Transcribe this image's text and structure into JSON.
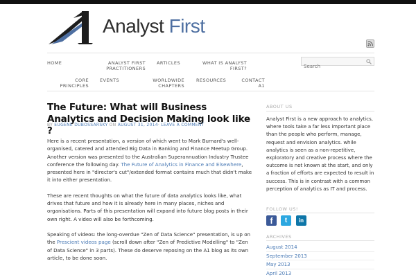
{
  "site": {
    "logo_word1": "Analyst",
    "logo_word2": "First",
    "brand_color": "#4e6fa1"
  },
  "nav": {
    "home": "HOME",
    "practitioners": [
      "ANALYST FIRST",
      "PRACTITIONERS"
    ],
    "articles": "ARTICLES",
    "what_is": [
      "WHAT IS ANALYST",
      "FIRST?"
    ],
    "core_principles": [
      "CORE",
      "PRINCIPLES"
    ],
    "events": "EVENTS",
    "worldwide_chapters": [
      "WORLDWIDE",
      "CHAPTERS"
    ],
    "resources": "RESOURCES",
    "contact": [
      "CONTACT",
      "A1"
    ]
  },
  "search": {
    "placeholder": "Search"
  },
  "post": {
    "title": "The Future: What will Business Analytics and Decision Making look like ?",
    "meta_by": "BY",
    "author": "EUGENE DUBOSSARSKY",
    "meta_on": "ON",
    "date": "AUGUST 31, 2014",
    "meta_sep": "·",
    "comment_link": "LEAVE A COMMENT",
    "p1_a": "Here is a recent presentation, a version of which went to Mark Burnard's well-organised, catered and attended Big Data in Banking and Finance Meetup Group. Another version was presented to the Australian Superannuation Industry Trustee conference the following day. ",
    "p1_link": "The Future of Analytics in Finance and Elsewhere",
    "p1_b": ", presented here in \"director's cut\"/extended format contains much that didn't make it into either presentation.",
    "p2": "These are recent thoughts on what the future of data analytics looks like, what drives that future and how it is already here in many places, niches and organisations.  Parts of this presentation will expand into future blog posts in their own right. A video will also be forthcoming.",
    "p3_a": "Speaking of videos:  the  long-overdue \"Zen of Data Science\" presentation, is up on the ",
    "p3_link": "Prescient videos page",
    "p3_b": " (scroll down after \"Zen of Predictive Modelling\"  to \"Zen of Data Science\" in 3 parts). These do deserve reposing on the A1 blog as its own article, to be done soon."
  },
  "sidebar": {
    "about_heading": "ABOUT US",
    "about_text": "Analyst First is a new approach to analytics, where tools take a far less important place than the people who perform, manage, request and envision analytics. while analytics is seen as a non-repetitive, exploratory and creative process where the outcome is not known at the start, and only a fraction of efforts are expected to result in success. This is in contrast with a common perception of analytics as IT and process.",
    "follow_heading": "FOLLOW US!",
    "facebook": "f",
    "twitter": "t",
    "linkedin": "in",
    "archives_heading": "ARCHIVES",
    "archives": [
      "August 2014",
      "September 2013",
      "May 2013",
      "April 2013"
    ]
  }
}
